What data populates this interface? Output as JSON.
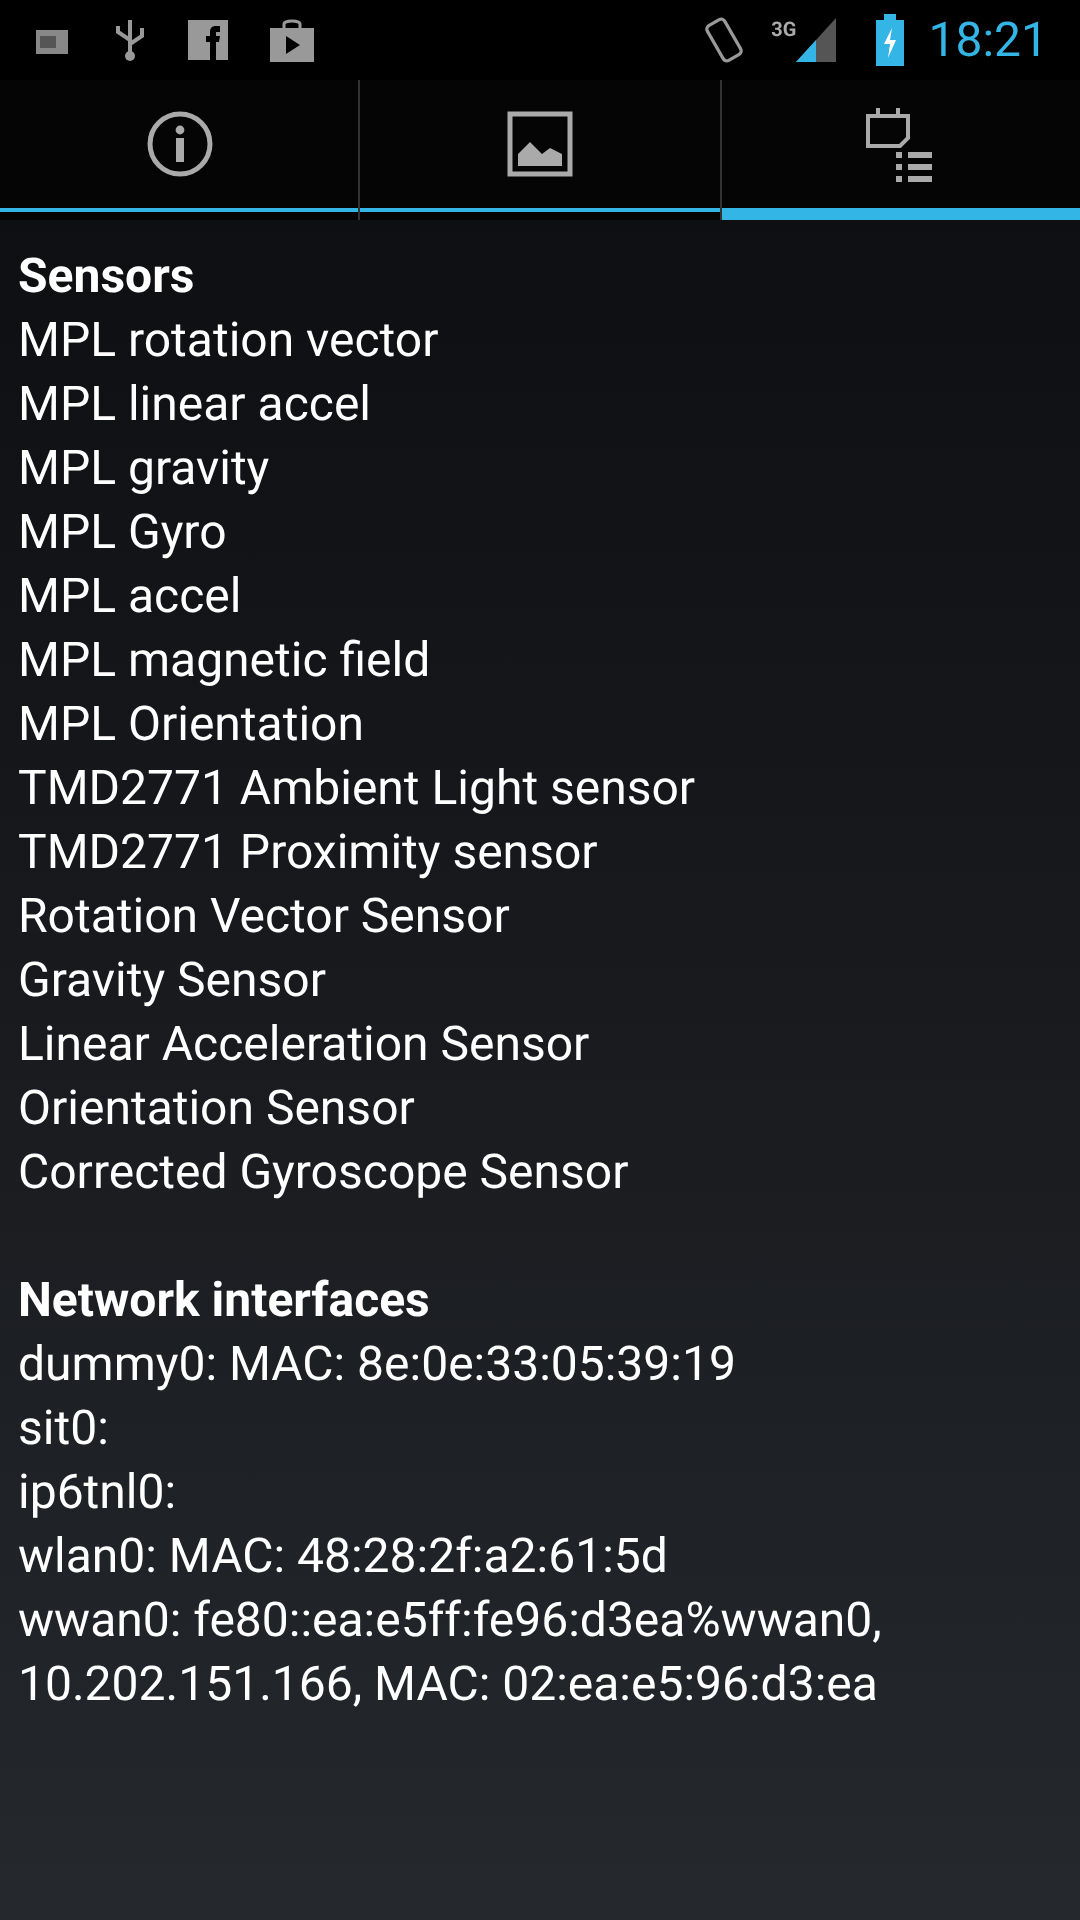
{
  "status_bar": {
    "network_type": "3G",
    "time": "18:21"
  },
  "tabs": [
    {
      "kind": "info",
      "selected": false
    },
    {
      "kind": "image",
      "selected": false
    },
    {
      "kind": "calendar-list",
      "selected": true
    }
  ],
  "sections": [
    {
      "title": "Sensors",
      "lines": [
        "MPL rotation vector",
        "MPL linear accel",
        "MPL gravity",
        "MPL Gyro",
        "MPL accel",
        "MPL magnetic field",
        "MPL Orientation",
        "TMD2771 Ambient Light sensor",
        "TMD2771 Proximity sensor",
        "Rotation Vector Sensor",
        "Gravity Sensor",
        "Linear Acceleration Sensor",
        "Orientation Sensor",
        "Corrected Gyroscope Sensor"
      ]
    },
    {
      "title": "Network interfaces",
      "lines": [
        "dummy0: MAC: 8e:0e:33:05:39:19",
        "sit0:",
        "ip6tnl0:",
        "wlan0: MAC: 48:28:2f:a2:61:5d",
        "wwan0: fe80::ea:e5ff:fe96:d3ea%wwan0, 10.202.151.166, MAC: 02:ea:e5:96:d3:ea"
      ]
    }
  ]
}
